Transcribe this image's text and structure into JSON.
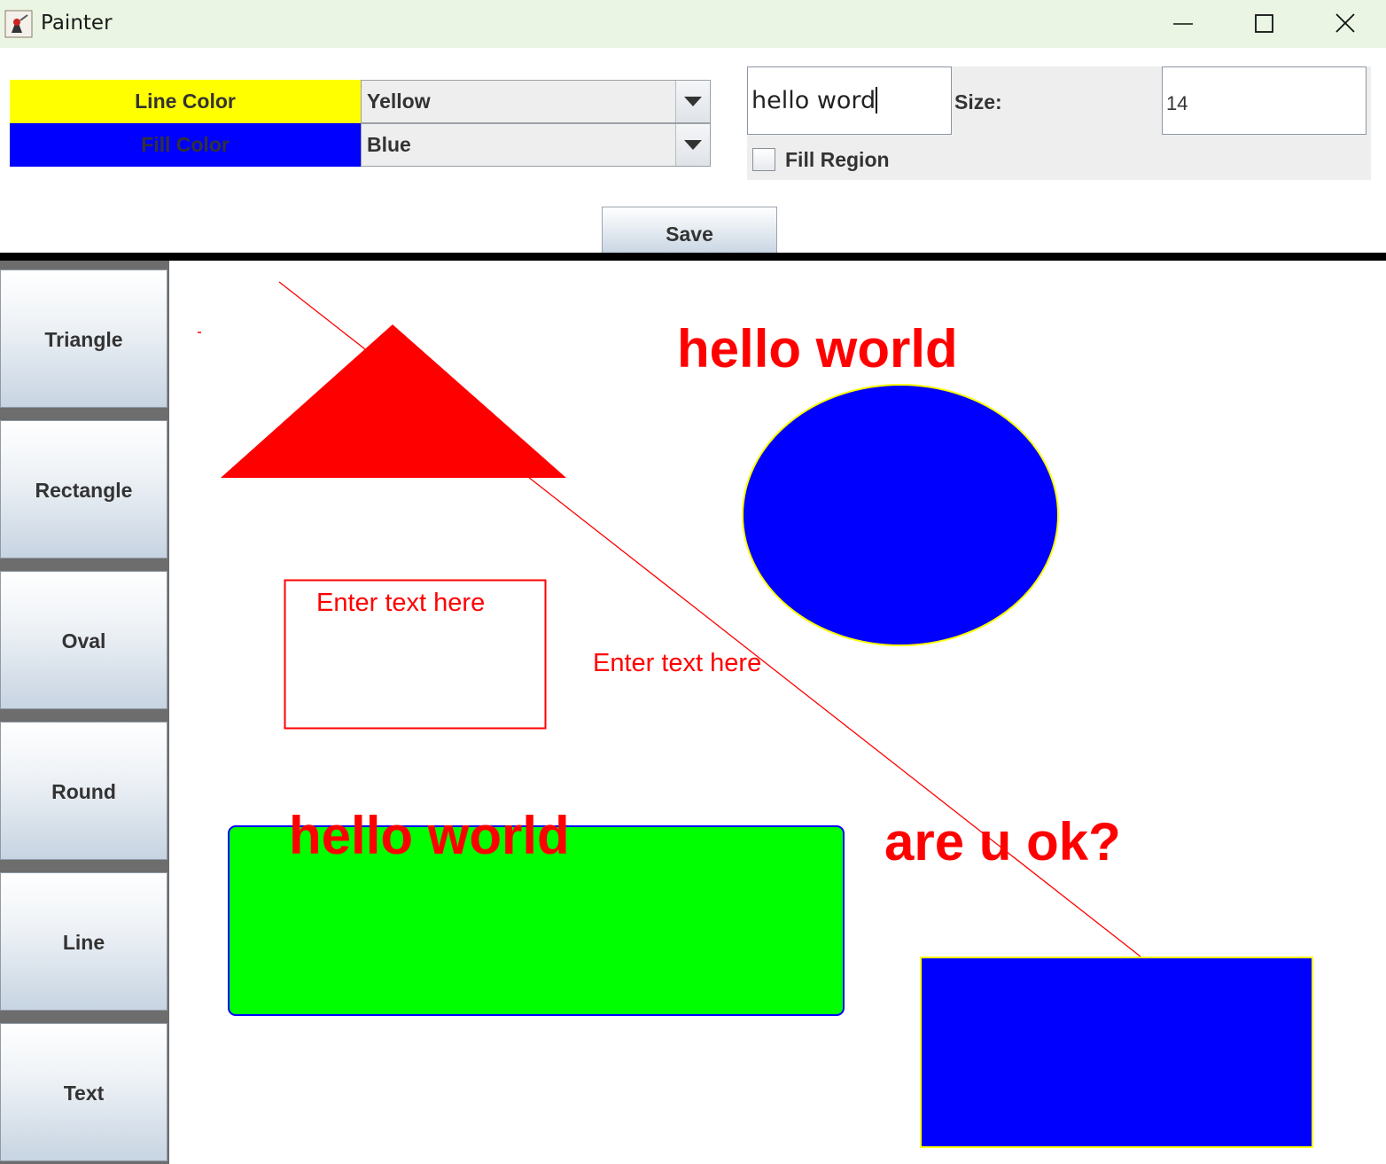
{
  "window": {
    "title": "Painter",
    "icons": {
      "app": "java-duke-icon",
      "minimize": "minimize-icon",
      "maximize": "maximize-icon",
      "close": "close-icon"
    }
  },
  "toolbar": {
    "line_color_label": "Line Color",
    "line_color_value": "Yellow",
    "fill_color_label": "Fill Color",
    "fill_color_value": "Blue",
    "text_input_value": "hello word",
    "size_label": "Size:",
    "size_value": "14",
    "fill_region_label": "Fill Region",
    "fill_region_checked": false,
    "save_label": "Save",
    "colors": {
      "line_color_swatch": "#ffff00",
      "fill_color_swatch": "#0000ff"
    }
  },
  "tools": [
    {
      "label": "Triangle"
    },
    {
      "label": "Rectangle"
    },
    {
      "label": "Oval"
    },
    {
      "label": "Round"
    },
    {
      "label": "Line"
    },
    {
      "label": "Text"
    }
  ],
  "canvas": {
    "texts": {
      "hello_world_top": "hello world",
      "enter_text_box": "Enter text here",
      "enter_text_free": "Enter text here",
      "hello_world_bottom": "hello world",
      "are_u_ok": "are u ok?"
    },
    "colors": {
      "red": "#ff0000",
      "blue": "#0000ff",
      "green": "#00ff00",
      "yellow": "#ffff00"
    }
  }
}
